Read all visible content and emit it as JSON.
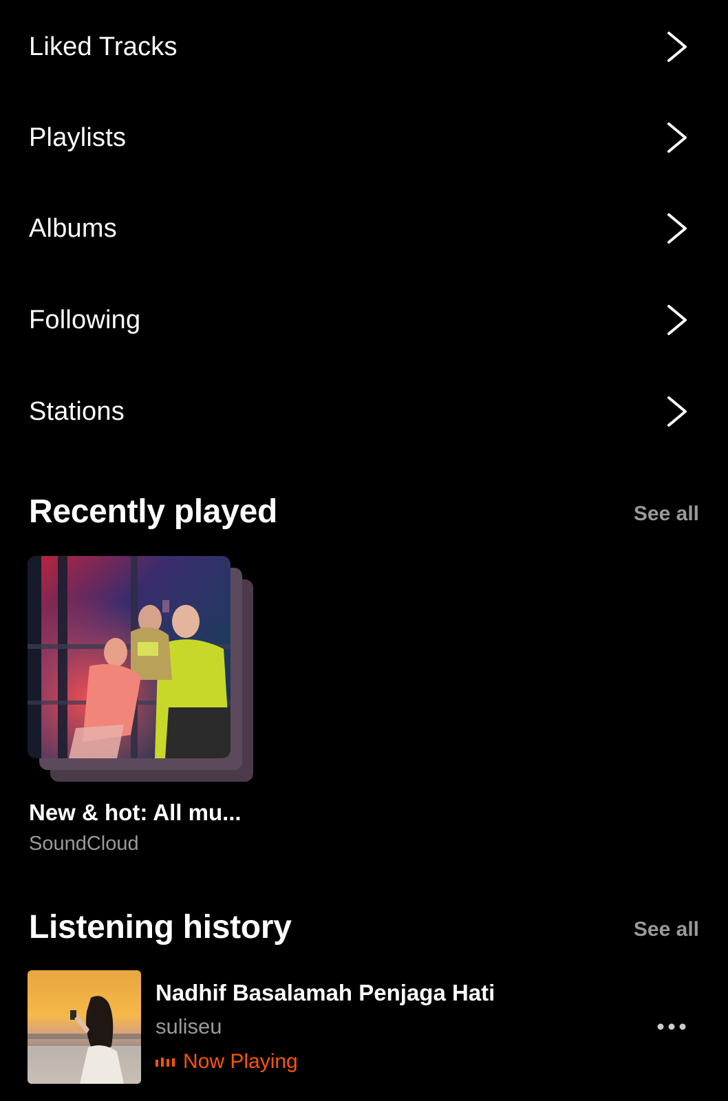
{
  "menu": {
    "items": [
      {
        "label": "Liked Tracks"
      },
      {
        "label": "Playlists"
      },
      {
        "label": "Albums"
      },
      {
        "label": "Following"
      },
      {
        "label": "Stations"
      }
    ]
  },
  "recently_played": {
    "title": "Recently played",
    "see_all": "See all",
    "items": [
      {
        "title": "New & hot: All mu...",
        "subtitle": "SoundCloud"
      }
    ]
  },
  "listening_history": {
    "title": "Listening history",
    "see_all": "See all",
    "items": [
      {
        "title": "Nadhif Basalamah Penjaga Hati",
        "artist": "suliseu",
        "status": "Now Playing"
      }
    ]
  },
  "colors": {
    "background": "#000000",
    "text_primary": "#ffffff",
    "text_secondary": "#9a9a9a",
    "accent": "#ff5500"
  },
  "icons": {
    "row_chevron": "chevron-right-icon",
    "more": "more-horizontal-icon",
    "playing": "equalizer-icon"
  }
}
